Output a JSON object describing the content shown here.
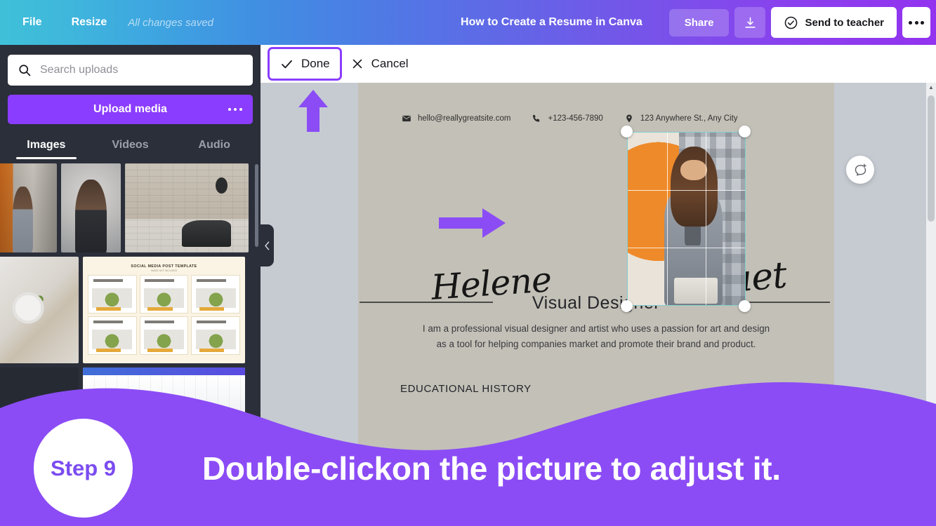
{
  "topbar": {
    "file_label": "File",
    "resize_label": "Resize",
    "saved_status": "All changes saved",
    "doc_title": "How to Create a Resume in Canva",
    "share_label": "Share",
    "download_icon": "download-icon",
    "send_to_teacher_label": "Send to teacher",
    "send_to_teacher_icon": "check-circle-icon",
    "more_icon": "more-horizontal-icon"
  },
  "sidebar": {
    "search": {
      "placeholder": "Search uploads",
      "value": "",
      "icon": "search-icon"
    },
    "upload_button_label": "Upload media",
    "upload_more_icon": "more-horizontal-icon",
    "tabs": [
      {
        "label": "Images",
        "active": true
      },
      {
        "label": "Videos",
        "active": false
      },
      {
        "label": "Audio",
        "active": false
      }
    ],
    "collapse_icon": "chevron-left-icon",
    "thumbnails": [
      {
        "name": "woman-in-office-photo"
      },
      {
        "name": "portrait-photo"
      },
      {
        "name": "brick-wall-scooter-photo"
      },
      {
        "name": "food-plate-photo"
      },
      {
        "name": "social-media-post-template",
        "caption": "SOCIAL MEDIA POST TEMPLATE",
        "subcaption": "IMAGE NOT INCLUDED"
      },
      {
        "name": "app-screenshot-thumbnail"
      }
    ]
  },
  "crop_toolbar": {
    "done_label": "Done",
    "done_icon": "check-icon",
    "cancel_label": "Cancel",
    "cancel_icon": "close-icon",
    "done_highlight_color": "#8b3dff"
  },
  "canvas": {
    "contact": [
      {
        "icon": "mail-icon",
        "text": "hello@reallygreatsite.com"
      },
      {
        "icon": "phone-icon",
        "text": "+123-456-7890"
      },
      {
        "icon": "location-pin-icon",
        "text": "123 Anywhere St., Any City"
      }
    ],
    "first_name": "Helene",
    "last_name": "Paquet",
    "job_title": "Visual Designer",
    "bio_line1": "I am a professional visual designer and artist who uses a passion for art and design",
    "bio_line2": "as a tool for helping companies market and promote their brand and product.",
    "section_heading": "EDUCATIONAL HISTORY",
    "selection_border_color": "#7fcfd1",
    "comment_icon": "add-comment-icon",
    "scroll_up_icon": "scroll-up-arrow-icon"
  },
  "annotations": {
    "arrow_up": "purple-up-arrow",
    "arrow_right": "purple-right-arrow",
    "arrow_color": "#8b4cf5"
  },
  "banner": {
    "step_label": "Step 9",
    "instruction": "Double-clickon the picture to adjust it.",
    "background_color": "#8b4cf5"
  }
}
